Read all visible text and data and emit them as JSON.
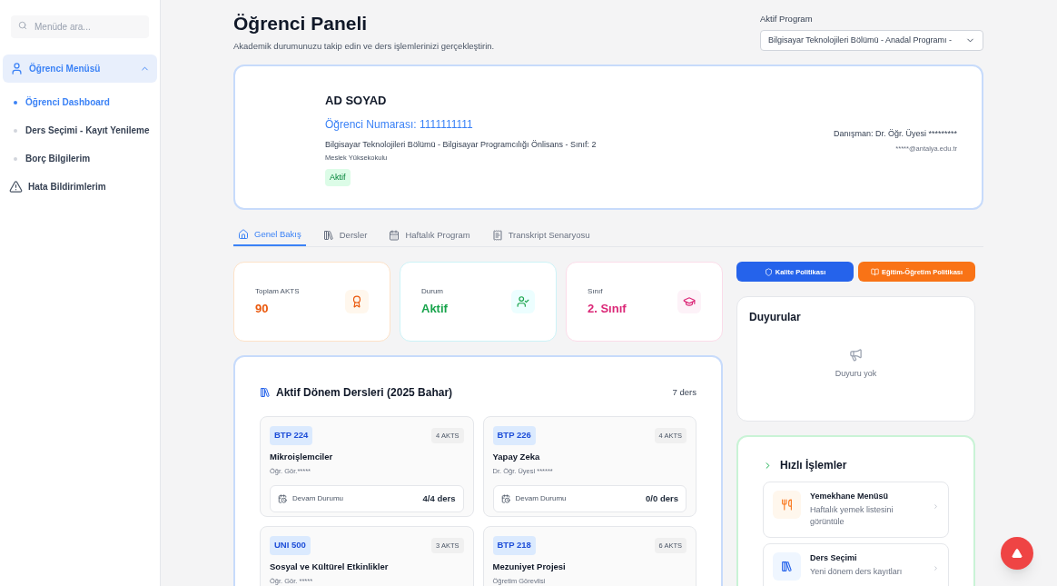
{
  "sidebar": {
    "search": {
      "placeholder": "Menüde ara..."
    },
    "menu": {
      "label": "Öğrenci Menüsü",
      "expanded": true,
      "items": [
        {
          "label": "Öğrenci Dashboard",
          "selected": true
        },
        {
          "label": "Ders Seçimi - Kayıt Yenileme",
          "selected": false
        },
        {
          "label": "Borç Bilgilerim",
          "selected": false
        }
      ]
    },
    "other_items": [
      {
        "label": "Hata Bildirimlerim"
      }
    ]
  },
  "header": {
    "title": "Öğrenci Paneli",
    "subtitle": "Akademik durumunuzu takip edin ve ders işlemlerinizi gerçekleştirin.",
    "program": {
      "label": "Aktif Program",
      "value": "Bilgisayar Teknolojileri Bölümü - Anadal Programı -"
    }
  },
  "profile": {
    "name": "AD SOYAD",
    "student_number": "Öğrenci Numarası: 1111111111",
    "department": "Bilgisayar Teknolojileri Bölümü - Bilgisayar Programcılığı Önlisans - Sınıf: 2",
    "school": "Meslek Yüksekokulu",
    "status": "Aktif",
    "advisor": "Danışman: Dr. Öğr. Üyesi *********",
    "email": "*****@antalya.edu.tr"
  },
  "tabs": [
    {
      "label": "Genel Bakış",
      "selected": true
    },
    {
      "label": "Dersler",
      "selected": false
    },
    {
      "label": "Haftalık Program",
      "selected": false
    },
    {
      "label": "Transkript Senaryosu",
      "selected": false
    }
  ],
  "stats": [
    {
      "label": "Toplam AKTS",
      "value": "90",
      "color": "#ea580c"
    },
    {
      "label": "Durum",
      "value": "Aktif",
      "color": "#16a34a"
    },
    {
      "label": "Sınıf",
      "value": "2. Sınıf",
      "color": "#db2777"
    }
  ],
  "courses": {
    "title": "Aktif Dönem Dersleri (2025 Bahar)",
    "count": "7 ders",
    "items": [
      {
        "code": "BTP 224",
        "akts": "4 AKTS",
        "name": "Mikroişlemciler",
        "instructor": "Öğr. Gör.*****",
        "attendance_label": "Devam Durumu",
        "attendance": "4/4 ders"
      },
      {
        "code": "BTP 226",
        "akts": "4 AKTS",
        "name": "Yapay Zeka",
        "instructor": "Dr. Öğr. Üyesi ******",
        "attendance_label": "Devam Durumu",
        "attendance": "0/0 ders"
      },
      {
        "code": "UNI 500",
        "akts": "3 AKTS",
        "name": "Sosyal ve Kültürel Etkinlikler",
        "instructor": "Öğr. Gör. *****"
      },
      {
        "code": "BTP 218",
        "akts": "6 AKTS",
        "name": "Mezuniyet Projesi",
        "instructor": "Öğretim Görevlisi"
      }
    ]
  },
  "policy_buttons": [
    {
      "label": "Kalite Politikası",
      "color": "#2563eb"
    },
    {
      "label": "Eğitim-Öğretim Politikası",
      "color": "#f97316"
    }
  ],
  "announcements": {
    "title": "Duyurular",
    "empty": "Duyuru yok"
  },
  "quick_actions": {
    "title": "Hızlı İşlemler",
    "items": [
      {
        "title": "Yemekhane Menüsü",
        "description": "Haftalık yemek listesini görüntüle"
      },
      {
        "title": "Ders Seçimi",
        "description": "Yeni dönem ders kayıtları"
      }
    ]
  }
}
